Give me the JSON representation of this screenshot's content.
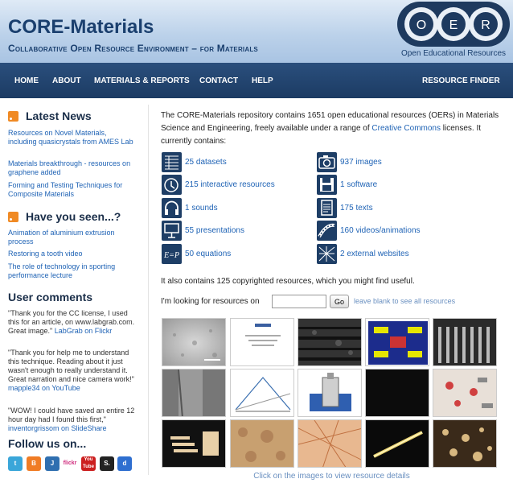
{
  "header": {
    "title": "CORE-Materials",
    "subtitle": "Collaborative Open Resource Environment – for Materials",
    "logo_letters": [
      "O",
      "E",
      "R"
    ],
    "logo_caption": "Open Educational Resources"
  },
  "nav": {
    "items": [
      "HOME",
      "ABOUT",
      "MATERIALS & REPORTS",
      "CONTACT",
      "HELP"
    ],
    "finder": "RESOURCE FINDER"
  },
  "sidebar": {
    "latest_news": {
      "heading": "Latest News",
      "items": [
        "Resources on Novel Materials, including quasicrystals from AMES Lab",
        "Materials breakthrough - resources on graphene added",
        "Forming and Testing Techniques for Composite Materials"
      ]
    },
    "have_you_seen": {
      "heading": "Have you seen...?",
      "items": [
        "Animation of aluminium extrusion process",
        "Restoring a tooth video",
        "The role of technology in sporting performance lecture"
      ]
    },
    "comments": {
      "heading": "User comments",
      "items": [
        {
          "text": "\"Thank you for the CC license, I used this for an article, on www.labgrab.com. Great image.\"",
          "source": "LabGrab on Flickr"
        },
        {
          "text": "\"Thank you for help me to understand this technique. Reading about it just wasn't enough to really understand it. Great narration and nice camera work!\"",
          "source": "mapple34 on YouTube"
        },
        {
          "text": "\"WOW! I could have saved an entire 12 hour day had I found this first,\"",
          "source": "inventorgrissom on SlideShare"
        }
      ]
    },
    "follow": {
      "heading": "Follow us on...",
      "icons": [
        {
          "name": "twitter-icon",
          "label": "t",
          "color": "#3aa6d9"
        },
        {
          "name": "blogger-icon",
          "label": "B",
          "color": "#f07c24"
        },
        {
          "name": "jorum-icon",
          "label": "J",
          "color": "#2f6fb0"
        },
        {
          "name": "flickr-icon",
          "label": "flickr",
          "color": "#ffffff"
        },
        {
          "name": "youtube-icon",
          "label": "You Tube",
          "color": "#cc2020"
        },
        {
          "name": "slideshare-icon",
          "label": "S.",
          "color": "#222222"
        },
        {
          "name": "delicious-icon",
          "label": "d",
          "color": "#2f6fd0"
        }
      ]
    }
  },
  "main": {
    "intro_prefix": "The CORE-Materials repository contains 1651 open educational resources (OERs) in Materials Science and Engineering, freely available under a range of ",
    "intro_link": "Creative Commons",
    "intro_suffix": " licenses. It currently contains:",
    "resources_left": [
      {
        "label": "25 datasets",
        "icon": "dataset-icon"
      },
      {
        "label": "215 interactive resources",
        "icon": "interactive-icon"
      },
      {
        "label": "1 sounds",
        "icon": "headphones-icon"
      },
      {
        "label": "55 presentations",
        "icon": "presentation-icon"
      },
      {
        "label": "50 equations",
        "icon": "equation-icon"
      }
    ],
    "resources_right": [
      {
        "label": "937 images",
        "icon": "camera-icon"
      },
      {
        "label": "1 software",
        "icon": "floppy-disk-icon"
      },
      {
        "label": "175 texts",
        "icon": "text-icon"
      },
      {
        "label": "160 videos/animations",
        "icon": "film-icon"
      },
      {
        "label": "2 external websites",
        "icon": "web-icon"
      }
    ],
    "also": "It also contains 125 copyrighted resources, which you might find useful.",
    "search_label": "I'm looking for resources on",
    "search_value": "",
    "go_label": "Go",
    "search_hint": "leave blank to see all resources",
    "caption": "Click on the images to view resource details"
  }
}
